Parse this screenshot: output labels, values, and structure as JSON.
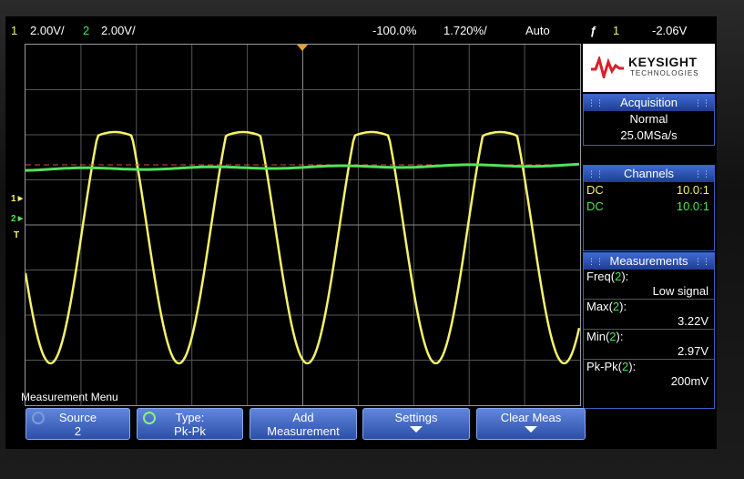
{
  "status_bar": {
    "ch1_number": "1",
    "ch1_scale": "2.00V/",
    "ch2_number": "2",
    "ch2_scale": "2.00V/",
    "time_delay": "-100.0%",
    "time_scale": "1.720%/",
    "trigger_mode": "Auto",
    "trigger_icon": "ƒ",
    "trigger_source": "1",
    "trigger_level": "-2.06V"
  },
  "logo": {
    "name": "KEYSIGHT",
    "sub": "TECHNOLOGIES"
  },
  "acquisition": {
    "title": "Acquisition",
    "mode": "Normal",
    "rate": "25.0MSa/s"
  },
  "channels": {
    "title": "Channels",
    "rows": [
      {
        "coupling": "DC",
        "probe": "10.0:1",
        "color": "#f5f26b"
      },
      {
        "coupling": "DC",
        "probe": "10.0:1",
        "color": "#52e35a"
      }
    ]
  },
  "measurements": {
    "title": "Measurements",
    "items": [
      {
        "label": "Freq",
        "source": "2",
        "value": "Low signal"
      },
      {
        "label": "Max",
        "source": "2",
        "value": "3.22V"
      },
      {
        "label": "Min",
        "source": "2",
        "value": "2.97V"
      },
      {
        "label": "Pk-Pk",
        "source": "2",
        "value": "200mV"
      }
    ]
  },
  "markers": {
    "ch1": "1",
    "ch2": "2",
    "trigger": "T"
  },
  "menu": {
    "title": "Measurement Menu",
    "softkeys": [
      {
        "line1": "Source",
        "line2": "2"
      },
      {
        "line1": "Type:",
        "line2": "Pk-Pk"
      },
      {
        "line1": "Add",
        "line2": "Measurement"
      },
      {
        "line1": "Settings",
        "line2": ""
      },
      {
        "line1": "Clear Meas",
        "line2": ""
      }
    ]
  },
  "colors": {
    "ch1": "#f5f26b",
    "ch2": "#52e35a",
    "softkey": "#3f6ad0",
    "panel_header": "#2f52b0"
  }
}
